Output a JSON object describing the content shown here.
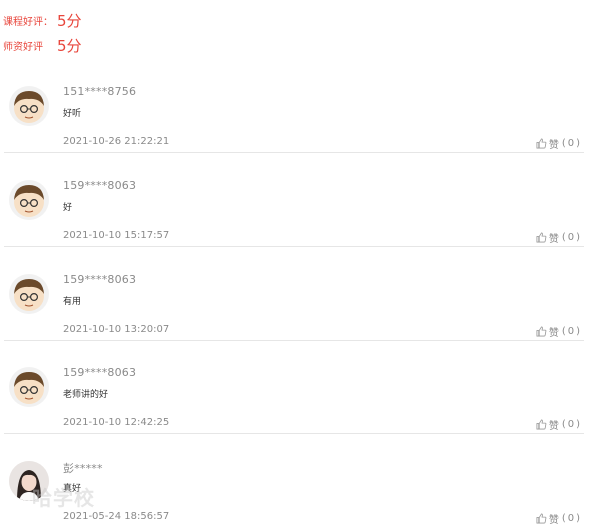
{
  "ratings": [
    {
      "label": "课程好评：",
      "score": "5分"
    },
    {
      "label": "师资好评",
      "score": "5分"
    }
  ],
  "comments": [
    {
      "user": "151****8756",
      "text": "好听",
      "time": "2021-10-26 21:22:21",
      "like_label": "赞",
      "like_count": "0",
      "avatar": "cartoon-boy"
    },
    {
      "user": "159****8063",
      "text": "好",
      "time": "2021-10-10 15:17:57",
      "like_label": "赞",
      "like_count": "0",
      "avatar": "cartoon-boy"
    },
    {
      "user": "159****8063",
      "text": "有用",
      "time": "2021-10-10 13:20:07",
      "like_label": "赞",
      "like_count": "0",
      "avatar": "cartoon-boy"
    },
    {
      "user": "159****8063",
      "text": "老师讲的好",
      "time": "2021-10-10 12:42:25",
      "like_label": "赞",
      "like_count": "0",
      "avatar": "cartoon-boy"
    },
    {
      "user": "彭*****",
      "text": "真好",
      "time": "2021-05-24 18:56:57",
      "like_label": "赞",
      "like_count": "0",
      "avatar": "photo-girl"
    }
  ],
  "watermark": "哈学校",
  "colors": {
    "accent": "#e8463c",
    "muted": "#8a8a8a",
    "divider": "#e6e6e6"
  }
}
